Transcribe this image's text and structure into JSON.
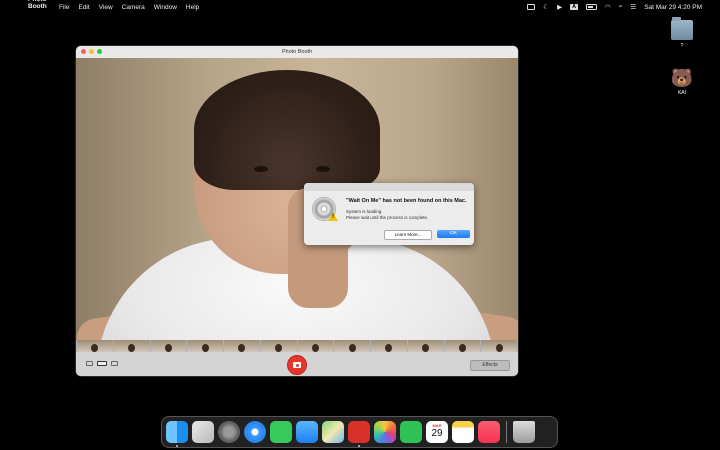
{
  "menubar": {
    "apple": "",
    "app_name": "Photo Booth",
    "menus": [
      "File",
      "Edit",
      "View",
      "Camera",
      "Window",
      "Help"
    ],
    "input_badge": "A",
    "clock": "Sat Mar 29  4:20 PM"
  },
  "desktop": {
    "folder_label": "?",
    "user_label": "KAI"
  },
  "window": {
    "title": "Photo Booth",
    "effects_label": "Effects"
  },
  "alert": {
    "title": "\"Wait On Me\" has not been found on this Mac.",
    "line1": "System is loading.",
    "line2": "Please wait until the process is complete.",
    "learn_more": "Learn More...",
    "ok": "OK"
  },
  "dock": {
    "calendar_month": "MAR",
    "calendar_day": "29",
    "apps": [
      "finder",
      "launchpad",
      "system-settings",
      "safari",
      "messages",
      "mail",
      "maps",
      "photo-booth",
      "photos",
      "facetime",
      "calendar",
      "notes",
      "music",
      "trash"
    ]
  },
  "colors": {
    "shutter": "#e8352b",
    "ok_button": "#1a7cf5"
  }
}
